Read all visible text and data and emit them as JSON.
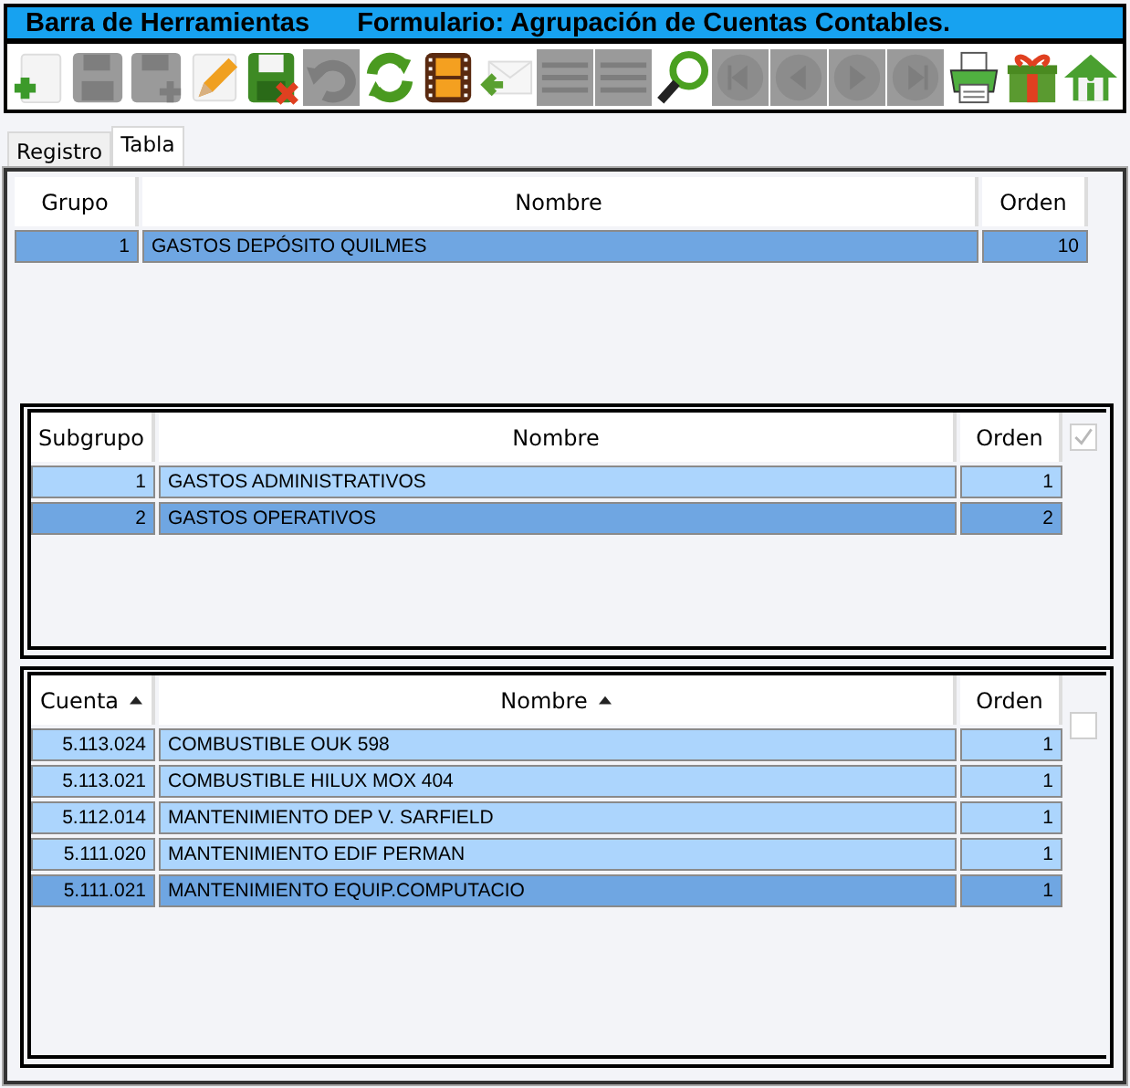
{
  "window": {
    "title": "Barra de Herramientas",
    "form_title": "Formulario: Agrupación de Cuentas Contables."
  },
  "toolbar": [
    {
      "kind": "add",
      "disabled": false
    },
    {
      "kind": "save",
      "disabled": true
    },
    {
      "kind": "save_add",
      "disabled": true
    },
    {
      "kind": "edit",
      "disabled": false
    },
    {
      "kind": "save_cancel",
      "disabled": false
    },
    {
      "kind": "undo",
      "disabled": true
    },
    {
      "kind": "refresh",
      "disabled": false
    },
    {
      "kind": "film",
      "disabled": false
    },
    {
      "kind": "mail_back",
      "disabled": false
    },
    {
      "kind": "list",
      "disabled": true
    },
    {
      "kind": "list",
      "disabled": true
    },
    {
      "kind": "search",
      "disabled": false
    },
    {
      "kind": "first",
      "disabled": true
    },
    {
      "kind": "prev",
      "disabled": true
    },
    {
      "kind": "next",
      "disabled": true
    },
    {
      "kind": "last",
      "disabled": true
    },
    {
      "kind": "print",
      "disabled": false
    },
    {
      "kind": "gift",
      "disabled": false
    },
    {
      "kind": "home",
      "disabled": false
    }
  ],
  "tabs": [
    {
      "label": "Registro",
      "selected": false
    },
    {
      "label": "Tabla",
      "selected": true
    }
  ],
  "grids": [
    {
      "columns": [
        {
          "label": "Grupo",
          "sorted": false
        },
        {
          "label": "Nombre",
          "sorted": false
        },
        {
          "label": "Orden",
          "sorted": false
        }
      ],
      "rows": [
        {
          "cells": [
            "1",
            "GASTOS DEPÓSITO QUILMES",
            "10"
          ],
          "selected": true
        }
      ]
    },
    {
      "checkbox": {
        "checked": true
      },
      "columns": [
        {
          "label": "Subgrupo",
          "sorted": false
        },
        {
          "label": "Nombre",
          "sorted": false
        },
        {
          "label": "Orden",
          "sorted": false
        }
      ],
      "rows": [
        {
          "cells": [
            "1",
            "GASTOS ADMINISTRATIVOS",
            "1"
          ],
          "selected": false
        },
        {
          "cells": [
            "2",
            "GASTOS OPERATIVOS",
            "2"
          ],
          "selected": true
        }
      ]
    },
    {
      "checkbox": {
        "checked": false
      },
      "columns": [
        {
          "label": "Cuenta",
          "sorted": true
        },
        {
          "label": "Nombre",
          "sorted": true
        },
        {
          "label": "Orden",
          "sorted": false
        }
      ],
      "rows": [
        {
          "cells": [
            "5.113.024",
            "COMBUSTIBLE OUK 598",
            "1"
          ],
          "selected": false
        },
        {
          "cells": [
            "5.113.021",
            "COMBUSTIBLE HILUX MOX 404",
            "1"
          ],
          "selected": false
        },
        {
          "cells": [
            "5.112.014",
            "MANTENIMIENTO DEP V. SARFIELD",
            "1"
          ],
          "selected": false
        },
        {
          "cells": [
            "5.111.020",
            "MANTENIMIENTO EDIF PERMAN",
            "1"
          ],
          "selected": false
        },
        {
          "cells": [
            "5.111.021",
            "MANTENIMIENTO EQUIP.COMPUTACIO",
            "1"
          ],
          "selected": true
        }
      ]
    }
  ]
}
